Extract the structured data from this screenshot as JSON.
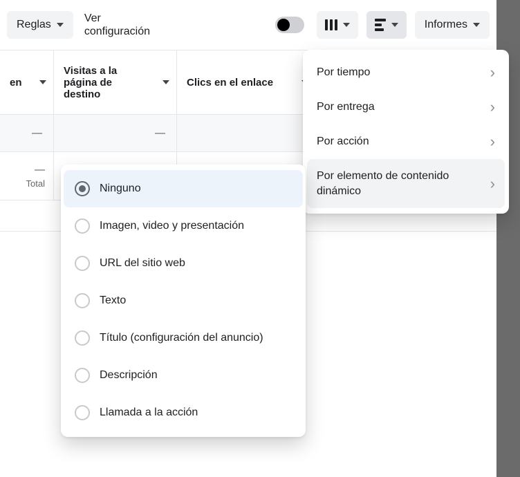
{
  "toolbar": {
    "rules_label": "Reglas",
    "config_label": "Ver\nconfiguración",
    "reports_label": "Informes"
  },
  "columns": {
    "c0": "en",
    "c1": "Visitas a la página de destino",
    "c2": "Clics en el enlace"
  },
  "row1": {
    "c0": "—",
    "c1": "—",
    "c2": ""
  },
  "total": {
    "c0_dash": "—",
    "c0_label": "Total"
  },
  "breakdown_menu": {
    "items": [
      {
        "label": "Por tiempo",
        "hover": false
      },
      {
        "label": "Por entrega",
        "hover": false
      },
      {
        "label": "Por acción",
        "hover": false
      },
      {
        "label": "Por elemento de contenido dinámico",
        "hover": true
      }
    ]
  },
  "radio_menu": {
    "items": [
      {
        "label": "Ninguno",
        "selected": true
      },
      {
        "label": "Imagen, video y presentación",
        "selected": false
      },
      {
        "label": "URL del sitio web",
        "selected": false
      },
      {
        "label": "Texto",
        "selected": false
      },
      {
        "label": "Título (configuración del anuncio)",
        "selected": false
      },
      {
        "label": "Descripción",
        "selected": false
      },
      {
        "label": "Llamada a la acción",
        "selected": false
      }
    ]
  }
}
